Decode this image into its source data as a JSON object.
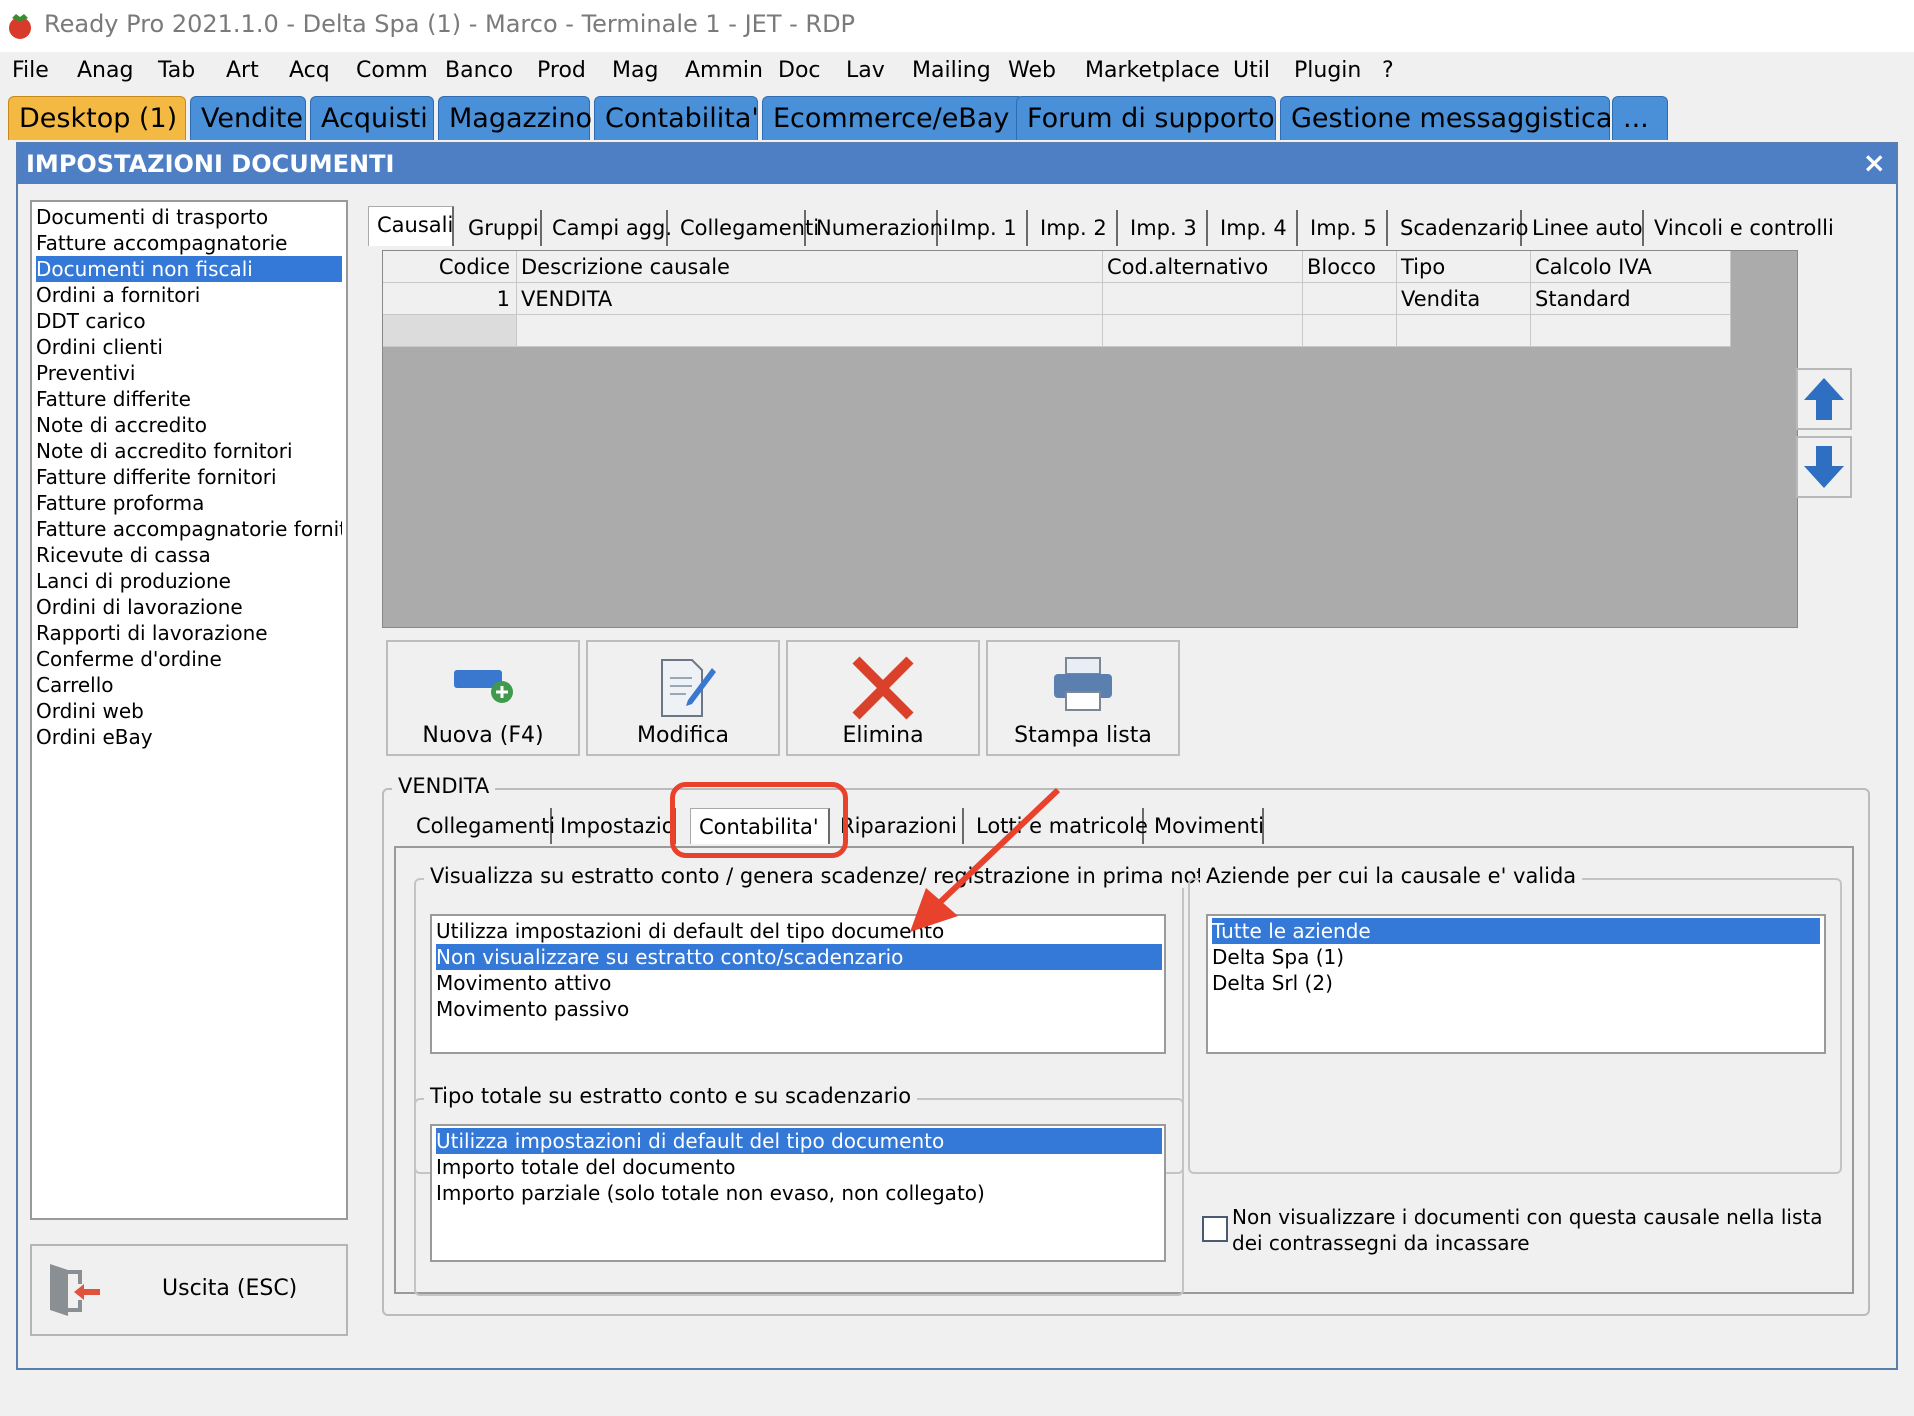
{
  "window": {
    "title": "Ready Pro 2021.1.0 - Delta Spa (1) - Marco - Terminale 1 - JET - RDP"
  },
  "menubar": [
    "File",
    "Anag",
    "Tab",
    "Art",
    "Acq",
    "Comm",
    "Banco",
    "Prod",
    "Mag",
    "Ammin",
    "Doc",
    "Lav",
    "Mailing",
    "Web",
    "Marketplace",
    "Util",
    "Plugin",
    "?"
  ],
  "main_tabs": [
    "Desktop (1)",
    "Vendite",
    "Acquisti",
    "Magazzino",
    "Contabilita'",
    "Ecommerce/eBay",
    "Forum di supporto",
    "Gestione messaggistica",
    "..."
  ],
  "dialog": {
    "title": "IMPOSTAZIONI DOCUMENTI",
    "close": "×"
  },
  "doc_types": [
    "Documenti di trasporto",
    "Fatture accompagnatorie",
    "Documenti non fiscali",
    "Ordini a fornitori",
    "DDT carico",
    "Ordini clienti",
    "Preventivi",
    "Fatture differite",
    "Note di accredito",
    "Note di accredito fornitori",
    "Fatture differite fornitori",
    "Fatture proforma",
    "Fatture accompagnatorie fornito",
    "Ricevute di cassa",
    "Lanci di produzione",
    "Ordini di lavorazione",
    "Rapporti di lavorazione",
    "Conferme d'ordine",
    "Carrello",
    "Ordini web",
    "Ordini eBay"
  ],
  "doc_selected": "Documenti non fiscali",
  "exit_button": "Uscita (ESC)",
  "settings_tabs": [
    "Causali",
    "Gruppi",
    "Campi agg.",
    "Collegamenti",
    "Numerazioni",
    "Imp. 1",
    "Imp. 2",
    "Imp. 3",
    "Imp. 4",
    "Imp. 5",
    "Scadenzario",
    "Linee auto",
    "Vincoli e controlli"
  ],
  "grid": {
    "columns": [
      "Codice",
      "Descrizione causale",
      "Cod.alternativo",
      "Blocco",
      "Tipo",
      "Calcolo IVA"
    ],
    "rows": [
      [
        "1",
        "VENDITA",
        "",
        "",
        "Vendita",
        "Standard"
      ]
    ]
  },
  "toolbar": {
    "new": "Nuova (F4)",
    "edit": "Modifica",
    "delete": "Elimina",
    "print": "Stampa lista"
  },
  "causale_group": "VENDITA",
  "detail_tabs": [
    "Collegamenti",
    "Impostazioni",
    "Contabilita'",
    "Riparazioni",
    "Lotti e matricole",
    "Movimenti"
  ],
  "statement_group": {
    "legend": "Visualizza su estratto conto / genera scadenze/ registrazione in prima nota",
    "options": [
      "Utilizza impostazioni di default del tipo documento",
      "Non visualizzare su estratto conto/scadenzario",
      "Movimento attivo",
      "Movimento passivo"
    ],
    "selected": "Non visualizzare su estratto conto/scadenzario"
  },
  "companies_group": {
    "legend": "Aziende per cui la causale e' valida",
    "options": [
      "Tutte le aziende",
      "Delta Spa (1)",
      "Delta Srl (2)"
    ],
    "selected": "Tutte le aziende"
  },
  "total_group": {
    "legend": "Tipo totale su estratto conto e su scadenzario",
    "options": [
      "Utilizza impostazioni di default del tipo documento",
      "Importo totale del documento",
      "Importo parziale (solo totale non evaso, non collegato)"
    ],
    "selected": "Utilizza impostazioni di default del tipo documento"
  },
  "checkbox": {
    "label_line1": "Non visualizzare i documenti con questa causale nella lista",
    "label_line2": "dei contrassegni da incassare",
    "checked": false
  },
  "colors": {
    "accent": "#3478d8",
    "tab_blue": "#4a90d9",
    "tab_active": "#f4b942",
    "header": "#4e7ec4",
    "annotation": "#e8412c"
  }
}
